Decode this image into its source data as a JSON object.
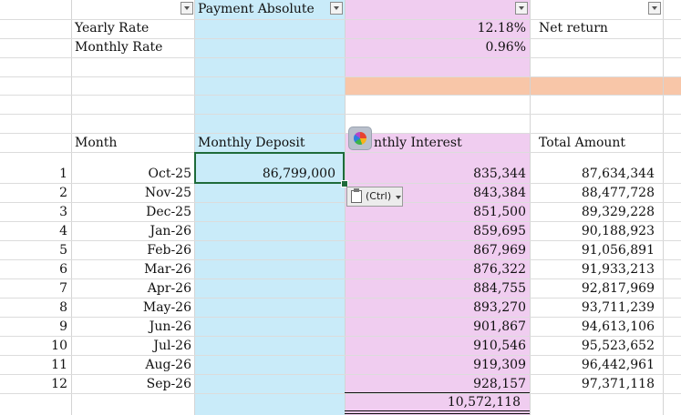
{
  "colors": {
    "blue_column": "#c9ebf9",
    "pink_column": "#f0cdf0",
    "orange_band": "#f8c6a8",
    "selection_border": "#1e6b3a"
  },
  "header": {
    "payment_absolute": "Payment Absolute"
  },
  "rates": {
    "yearly_label": "Yearly Rate",
    "yearly_value": "12.18%",
    "monthly_label": "Monthly Rate",
    "monthly_value": "0.96%",
    "net_return_label": "Net return"
  },
  "table": {
    "headers": {
      "month": "Month",
      "monthly_deposit": "Monthly Deposit",
      "monthly_interest_visible": "nthly Interest",
      "total_amount": "Total Amount"
    },
    "rows": [
      {
        "n": "1",
        "month": "Oct-25",
        "deposit": "86,799,000",
        "interest": "835,344",
        "total": "87,634,344"
      },
      {
        "n": "2",
        "month": "Nov-25",
        "deposit": "",
        "interest": "843,384",
        "total": "88,477,728"
      },
      {
        "n": "3",
        "month": "Dec-25",
        "deposit": "",
        "interest": "851,500",
        "total": "89,329,228"
      },
      {
        "n": "4",
        "month": "Jan-26",
        "deposit": "",
        "interest": "859,695",
        "total": "90,188,923"
      },
      {
        "n": "5",
        "month": "Feb-26",
        "deposit": "",
        "interest": "867,969",
        "total": "91,056,891"
      },
      {
        "n": "6",
        "month": "Mar-26",
        "deposit": "",
        "interest": "876,322",
        "total": "91,933,213"
      },
      {
        "n": "7",
        "month": "Apr-26",
        "deposit": "",
        "interest": "884,755",
        "total": "92,817,969"
      },
      {
        "n": "8",
        "month": "May-26",
        "deposit": "",
        "interest": "893,270",
        "total": "93,711,239"
      },
      {
        "n": "9",
        "month": "Jun-26",
        "deposit": "",
        "interest": "901,867",
        "total": "94,613,106"
      },
      {
        "n": "10",
        "month": "Jul-26",
        "deposit": "",
        "interest": "910,546",
        "total": "95,523,652"
      },
      {
        "n": "11",
        "month": "Aug-26",
        "deposit": "",
        "interest": "919,309",
        "total": "96,442,961"
      },
      {
        "n": "12",
        "month": "Sep-26",
        "deposit": "",
        "interest": "928,157",
        "total": "97,371,118"
      }
    ],
    "interest_total": "10,572,118"
  },
  "paste_options": {
    "label": "(Ctrl)",
    "icon": "clipboard-icon"
  },
  "copilot": {
    "icon": "copilot-icon"
  }
}
